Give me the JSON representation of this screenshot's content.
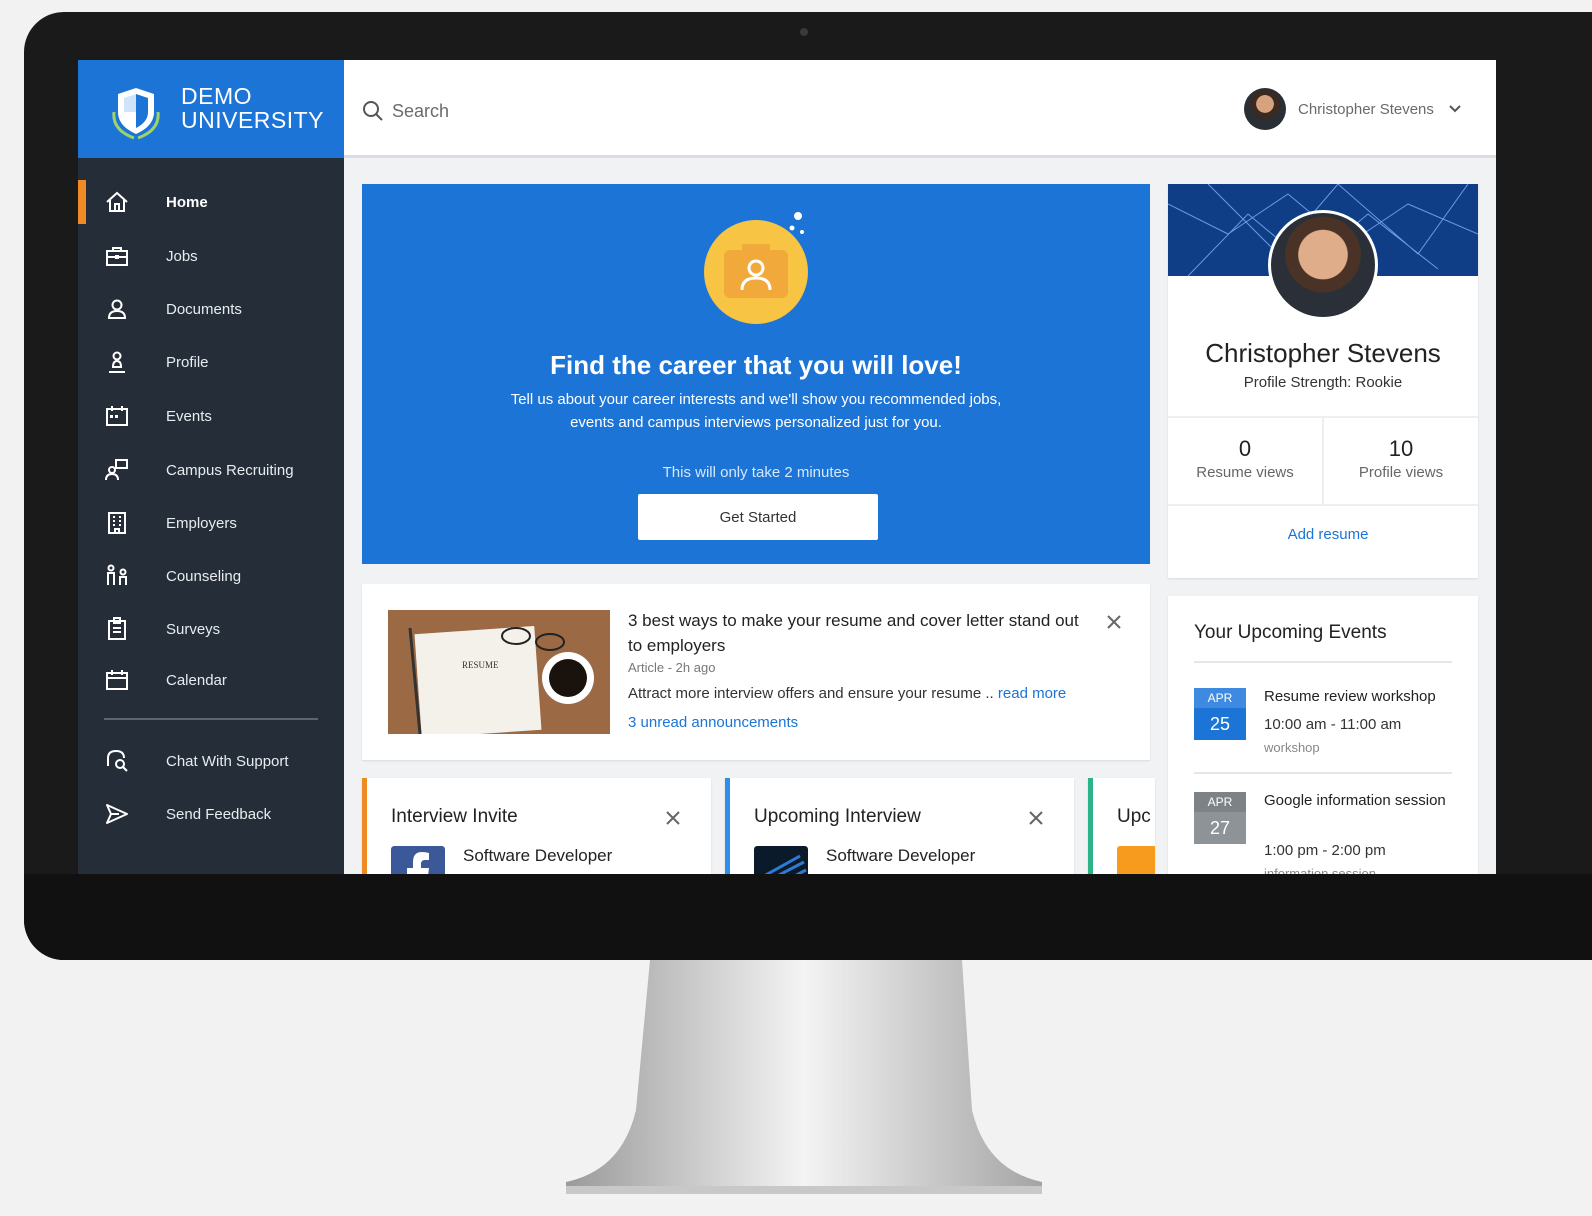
{
  "brand": {
    "line1": "DEMO",
    "line2": "UNIVERSITY"
  },
  "search": {
    "placeholder": "Search"
  },
  "user": {
    "name": "Christopher Stevens"
  },
  "sidebar": {
    "items": [
      {
        "label": "Home",
        "icon": "home-icon"
      },
      {
        "label": "Jobs",
        "icon": "briefcase-icon"
      },
      {
        "label": "Documents",
        "icon": "person-icon"
      },
      {
        "label": "Profile",
        "icon": "profile-pin-icon"
      },
      {
        "label": "Events",
        "icon": "calendar-grid-icon"
      },
      {
        "label": "Campus Recruiting",
        "icon": "recruiting-icon"
      },
      {
        "label": "Employers",
        "icon": "building-icon"
      },
      {
        "label": "Counseling",
        "icon": "counseling-icon"
      },
      {
        "label": "Surveys",
        "icon": "clipboard-icon"
      },
      {
        "label": "Calendar",
        "icon": "calendar-icon"
      }
    ],
    "support": [
      {
        "label": "Chat With Support",
        "icon": "chat-search-icon"
      },
      {
        "label": "Send Feedback",
        "icon": "send-icon"
      }
    ]
  },
  "hero": {
    "title": "Find the career that you will love!",
    "description": "Tell us about your career interests and we'll show you recommended jobs, events and campus interviews personalized just for you.",
    "note": "This will only take 2 minutes",
    "cta": "Get Started"
  },
  "article": {
    "title": "3 best ways to make your resume and cover letter stand out to employers",
    "meta": "Article - 2h ago",
    "excerpt": "Attract more interview offers and ensure your resume .. ",
    "read_more": "read more",
    "announcements": "3 unread announcements",
    "thumb_text": "RESUME"
  },
  "cards": [
    {
      "title": "Interview Invite",
      "job": "Software Developer",
      "accent": "#f08a24"
    },
    {
      "title": "Upcoming Interview",
      "job": "Software Developer",
      "accent": "#2d8fe8"
    },
    {
      "title": "Upc",
      "job": "",
      "accent": "#2db38a"
    }
  ],
  "profile": {
    "name": "Christopher Stevens",
    "strength": "Profile Strength: Rookie",
    "resume_views": "0",
    "resume_views_label": "Resume views",
    "profile_views": "10",
    "profile_views_label": "Profile views",
    "add_resume": "Add resume"
  },
  "events": {
    "title": "Your Upcoming Events",
    "items": [
      {
        "month": "APR",
        "day": "25",
        "name": "Resume review workshop",
        "time": "10:00 am - 11:00 am",
        "type": "workshop",
        "color": "#1b74d6"
      },
      {
        "month": "APR",
        "day": "27",
        "name": "Google information session",
        "time": "1:00 pm - 2:00 pm",
        "type": "information session",
        "color": "#8e9398"
      }
    ]
  },
  "colors": {
    "primary": "#1b74d6",
    "sidebar": "#252d38",
    "active": "#f08a24"
  }
}
